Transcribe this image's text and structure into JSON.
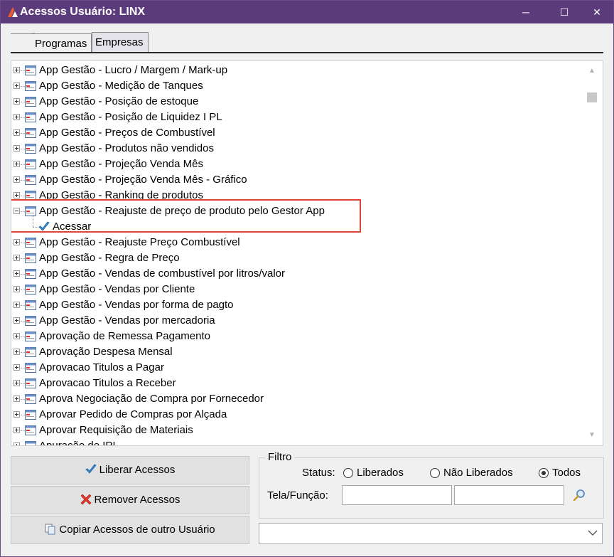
{
  "window": {
    "title": "Acessos Usuário: LINX",
    "minimize": "─",
    "maximize": "☐",
    "close": "✕"
  },
  "tabs": [
    {
      "label": "Programas",
      "active": true
    },
    {
      "label": "Empresas",
      "active": false
    }
  ],
  "tree": {
    "items": [
      {
        "label": "App Gestão - Lucro / Margem / Mark-up"
      },
      {
        "label": "App Gestão - Medição de Tanques"
      },
      {
        "label": "App Gestão - Posição de estoque"
      },
      {
        "label": "App Gestão - Posição de Liquidez I PL"
      },
      {
        "label": "App Gestão - Preços de Combustível"
      },
      {
        "label": "App Gestão - Produtos não vendidos"
      },
      {
        "label": "App Gestão - Projeção Venda Mês"
      },
      {
        "label": "App Gestão - Projeção Venda Mês - Gráfico"
      },
      {
        "label": "App Gestão - Ranking de produtos"
      },
      {
        "label": "App Gestão - Reajuste de preço de produto pelo Gestor App",
        "expanded": true,
        "child": "Acessar"
      },
      {
        "label": "App Gestão - Reajuste Preço Combustível"
      },
      {
        "label": "App Gestão - Regra de Preço"
      },
      {
        "label": "App Gestão - Vendas de combustível por litros/valor"
      },
      {
        "label": "App Gestão - Vendas por Cliente"
      },
      {
        "label": "App Gestão - Vendas por forma de pagto"
      },
      {
        "label": "App Gestão - Vendas por mercadoria"
      },
      {
        "label": "Aprovação de Remessa Pagamento"
      },
      {
        "label": "Aprovação Despesa Mensal"
      },
      {
        "label": "Aprovacao Titulos a Pagar"
      },
      {
        "label": "Aprovacao Titulos a Receber"
      },
      {
        "label": "Aprova Negociação de Compra por Fornecedor"
      },
      {
        "label": "Aprovar Pedido de Compras por Alçada"
      },
      {
        "label": "Aprovar Requisição de Materiais"
      },
      {
        "label": "Apuração de IPI"
      }
    ]
  },
  "buttons": {
    "liberar": "Liberar Acessos",
    "remover": "Remover Acessos",
    "copiar": "Copiar Acessos de outro Usuário"
  },
  "filtro": {
    "legend": "Filtro",
    "status_label": "Status:",
    "options": [
      "Liberados",
      "Não Liberados",
      "Todos"
    ],
    "selected": "Todos",
    "tela_label": "Tela/Função:",
    "input1_value": "",
    "input2_value": ""
  },
  "combo": {
    "value": ""
  },
  "colors": {
    "titlebar": "#5c3b7c",
    "highlight": "#e0453a"
  }
}
